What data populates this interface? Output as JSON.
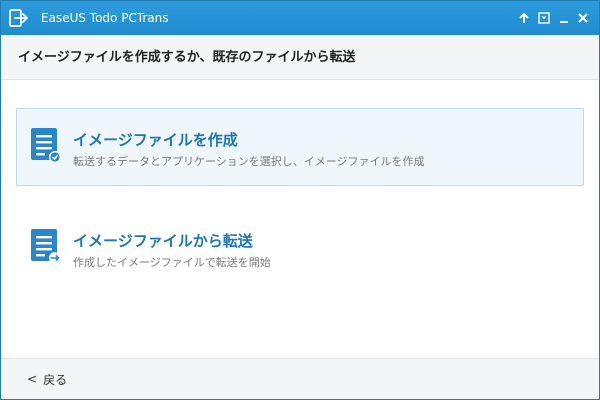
{
  "window": {
    "title": "EaseUS Todo PCTrans",
    "buttons": [
      "up-arrow-icon",
      "restore-icon",
      "minimize-icon",
      "close-icon"
    ]
  },
  "header": {
    "title": "イメージファイルを作成するか、既存のファイルから転送"
  },
  "options": [
    {
      "title": "イメージファイルを作成",
      "description": "転送するデータとアプリケーションを選択し、イメージファイルを作成",
      "icon": "document-check-icon",
      "selected": true
    },
    {
      "title": "イメージファイルから転送",
      "description": "作成したイメージファイルで転送を開始",
      "icon": "document-transfer-icon",
      "selected": false
    }
  ],
  "footer": {
    "back_label": "戻る",
    "back_chevron": "<"
  },
  "colors": {
    "titlebar": "#2196d8",
    "accent_text": "#1b76b4",
    "selected_bg": "#f0f7fc",
    "selected_border": "#bcdaed"
  }
}
